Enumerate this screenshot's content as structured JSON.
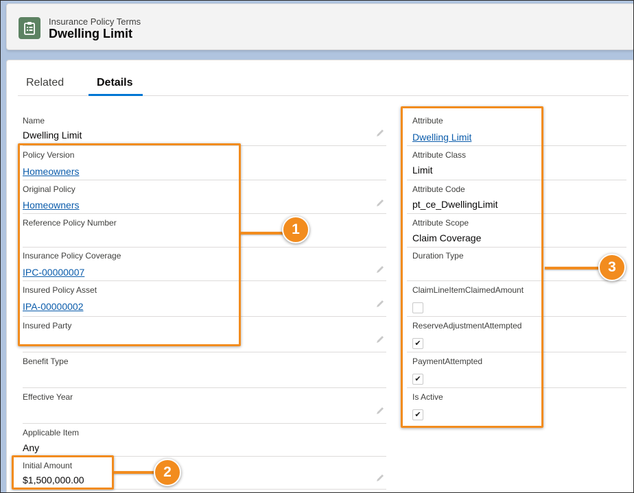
{
  "header": {
    "object_label": "Insurance Policy Terms",
    "record_title": "Dwelling Limit",
    "icon": "clipboard-list-icon"
  },
  "tabs": [
    {
      "label": "Related",
      "active": false
    },
    {
      "label": "Details",
      "active": true
    }
  ],
  "left_fields": [
    {
      "label": "Name",
      "value": "Dwelling Limit",
      "link": false,
      "editable": true
    },
    {
      "label": "Policy Version",
      "value": "Homeowners",
      "link": true,
      "editable": false
    },
    {
      "label": "Original Policy",
      "value": "Homeowners",
      "link": true,
      "editable": true
    },
    {
      "label": "Reference Policy Number",
      "value": "",
      "link": false,
      "editable": false
    },
    {
      "label": "Insurance Policy Coverage",
      "value": "IPC-00000007",
      "link": true,
      "editable": true
    },
    {
      "label": "Insured Policy Asset",
      "value": "IPA-00000002",
      "link": true,
      "editable": true
    },
    {
      "label": "Insured Party",
      "value": "",
      "link": false,
      "editable": true
    },
    {
      "label": "Benefit Type",
      "value": "",
      "link": false,
      "editable": false
    },
    {
      "label": "Effective Year",
      "value": "",
      "link": false,
      "editable": true
    },
    {
      "label": "Applicable Item",
      "value": "Any",
      "link": false,
      "editable": false
    },
    {
      "label": "Initial Amount",
      "value": "$1,500,000.00",
      "link": false,
      "editable": true
    }
  ],
  "right_fields": [
    {
      "label": "Attribute",
      "value": "Dwelling Limit",
      "link": true
    },
    {
      "label": "Attribute Class",
      "value": "Limit",
      "link": false
    },
    {
      "label": "Attribute Code",
      "value": "pt_ce_DwellingLimit",
      "link": false
    },
    {
      "label": "Attribute Scope",
      "value": "Claim Coverage",
      "link": false
    },
    {
      "label": "Duration Type",
      "value": "",
      "link": false
    }
  ],
  "right_checkboxes": [
    {
      "label": "ClaimLineItemClaimedAmount",
      "checked": false
    },
    {
      "label": "ReserveAdjustmentAttempted",
      "checked": true
    },
    {
      "label": "PaymentAttempted",
      "checked": true
    },
    {
      "label": "Is Active",
      "checked": true
    }
  ],
  "callouts": [
    "1",
    "2",
    "3"
  ],
  "colors": {
    "highlight": "#f28c1e",
    "link": "#0b5cab",
    "tab_underline": "#0176d3",
    "record_icon_bg": "#5c8262",
    "page_bg": "#b0c4df"
  }
}
